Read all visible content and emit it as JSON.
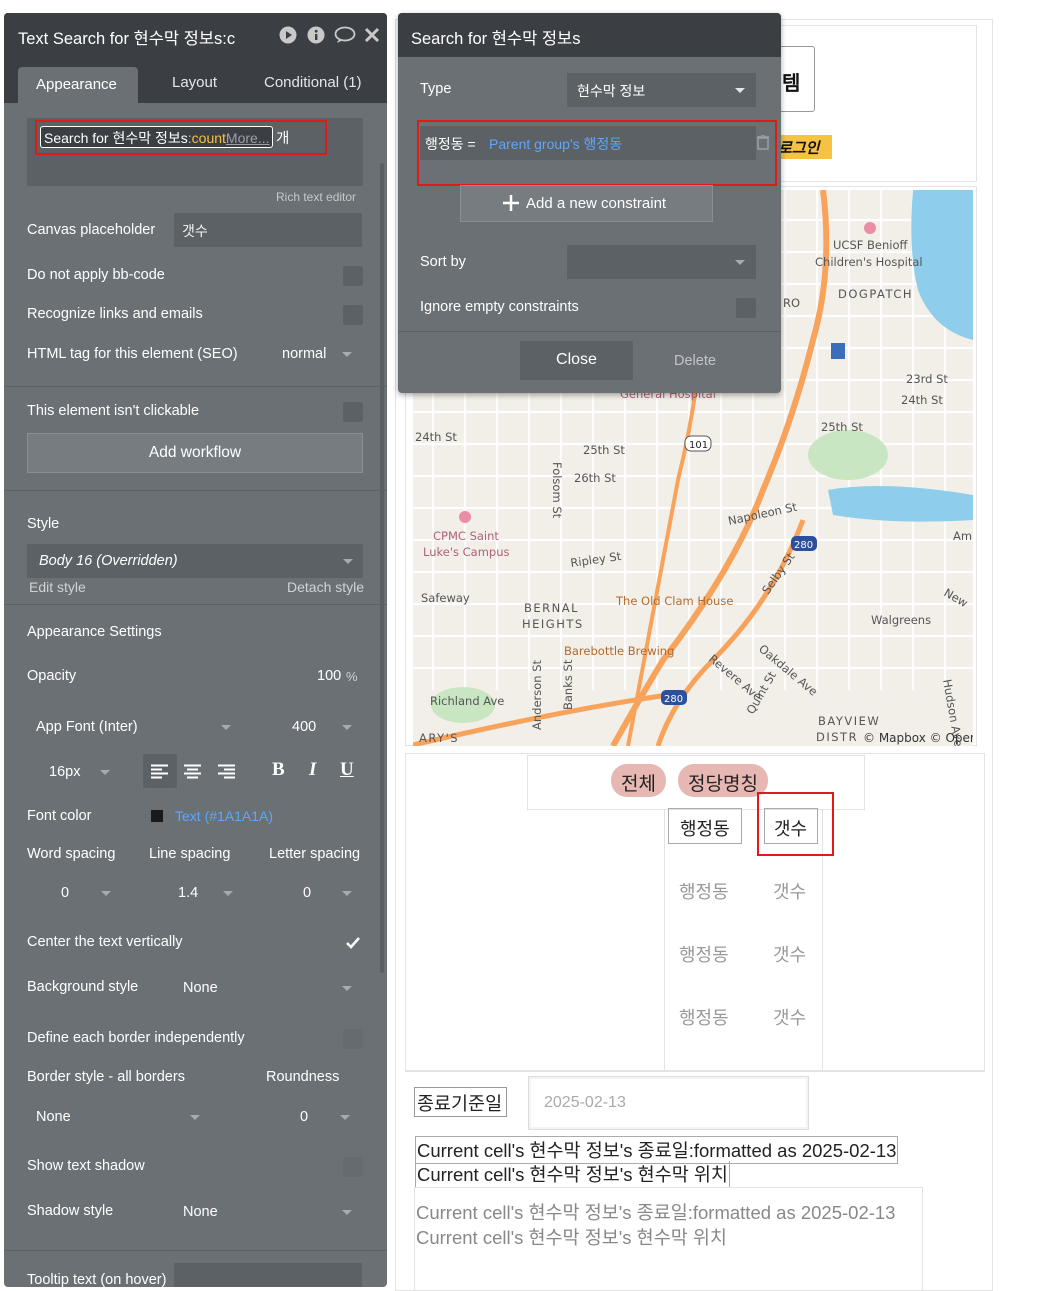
{
  "editor": {
    "title": "Text Search for 현수막 정보s:c",
    "tabs": [
      "Appearance",
      "Layout",
      "Conditional (1)"
    ],
    "rich_text": {
      "prefix": "Search for 현수막 정보s",
      "op": ":count",
      "more": "More...",
      "suffix": "개"
    },
    "rich_text_hint": "Rich text editor",
    "canvas_placeholder_label": "Canvas placeholder",
    "canvas_placeholder_value": "갯수",
    "no_bbcode": "Do not apply bb-code",
    "recognize_links": "Recognize links and emails",
    "html_tag_label": "HTML tag for this element (SEO)",
    "html_tag_value": "normal",
    "not_clickable": "This element isn't clickable",
    "add_workflow": "Add workflow",
    "style_label": "Style",
    "style_value": "Body 16 (Overridden)",
    "edit_style": "Edit style",
    "detach_style": "Detach style",
    "appearance_settings": "Appearance Settings",
    "opacity_label": "Opacity",
    "opacity_value": "100",
    "opacity_unit": "%",
    "font_family": "App Font (Inter)",
    "font_weight": "400",
    "font_size": "16px",
    "bold": "B",
    "italic": "I",
    "underline": "U",
    "font_color_label": "Font color",
    "font_color_value": "Text (#1A1A1A)",
    "font_color_hex": "#1A1A1A",
    "word_spacing": "Word spacing",
    "line_spacing": "Line spacing",
    "letter_spacing": "Letter spacing",
    "word_spacing_value": "0",
    "line_spacing_value": "1.4",
    "letter_spacing_value": "0",
    "center_vertically": "Center the text vertically",
    "center_vertically_checked": true,
    "background_style_label": "Background style",
    "background_style_value": "None",
    "define_border": "Define each border independently",
    "border_style_label": "Border style - all borders",
    "roundness_label": "Roundness",
    "border_style_value": "None",
    "roundness_value": "0",
    "text_shadow": "Show text shadow",
    "shadow_style_label": "Shadow style",
    "shadow_style_value": "None",
    "tooltip_label": "Tooltip text (on hover)"
  },
  "search_popup": {
    "title": "Search for 현수막 정보s",
    "type_label": "Type",
    "type_value": "현수막 정보",
    "constraint_key": "행정동 =",
    "constraint_value": "Parent group's 행정동",
    "add_constraint": "Add a new constraint",
    "sort_label": "Sort by",
    "ignore_empty": "Ignore empty constraints",
    "close": "Close",
    "delete": "Delete"
  },
  "canvas": {
    "header_partial": "템",
    "login_partial": "로그인",
    "map_labels": [
      "UCSF Benioff",
      "Children's Hospital",
      "DOGPATCH",
      "23rd St",
      "24th St",
      "25th St",
      "24th St",
      "25th St",
      "26th St",
      "Folsom St",
      "Napoleon St",
      "CPMC Saint",
      "Luke's Campus",
      "Ripley St",
      "Safeway",
      "BERNAL",
      "HEIGHTS",
      "The Old Clam House",
      "Barebottle Brewing",
      "Walgreens",
      "Oakdale Ave",
      "Revere Ave",
      "Selby St",
      "Quint St",
      "Richland Ave",
      "Anderson St",
      "Banks St",
      "BAYVIEW",
      "DISTR",
      "Hudson Ave",
      "Am",
      "New",
      "ARY'S",
      "General Hospital",
      "RO",
      "101",
      "280",
      "280"
    ],
    "map_attribution": "© Mapbox © Open",
    "filter_all": "전체",
    "filter_name": "정당명칭",
    "col_dong": "행정동",
    "col_count": "갯수",
    "rows": [
      [
        "행정동",
        "갯수"
      ],
      [
        "행정동",
        "갯수"
      ],
      [
        "행정동",
        "갯수"
      ]
    ],
    "end_date_label": "종료기준일",
    "end_date_value": "2025-02-13",
    "cell_line1": "Current cell's 현수막 정보's 종료일:formatted as 2025-02-13",
    "cell_line2": "Current cell's 현수막 정보's 현수막 위치"
  },
  "colors": {
    "panel": "#6b7075",
    "panel_header": "#3b3f44",
    "highlight": "#e0191b",
    "link": "#5aa7ff",
    "pill": "#e6b7b3",
    "count_op": "#f5c242"
  }
}
